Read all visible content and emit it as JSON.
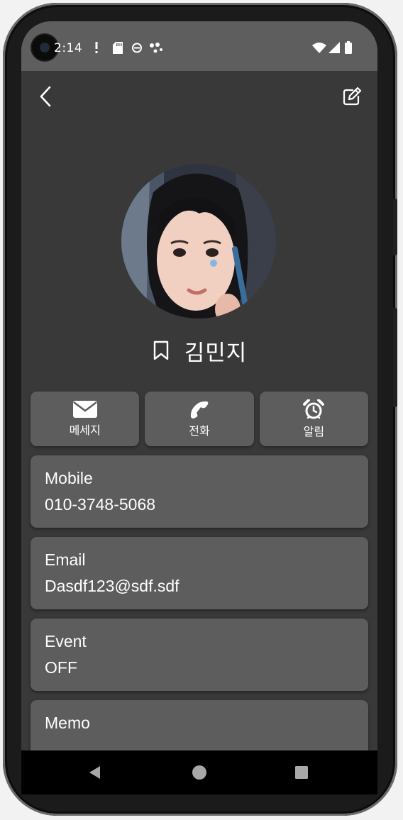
{
  "status": {
    "time": "2:14",
    "left_icons": [
      "alert-icon",
      "sd-card-icon",
      "sync-icon",
      "dots-icon"
    ],
    "right_icons": [
      "wifi-icon",
      "signal-icon",
      "battery-icon"
    ]
  },
  "toolbar": {
    "back_icon": "chevron-left-icon",
    "edit_icon": "edit-icon"
  },
  "contact": {
    "name": "김민지",
    "bookmark_icon": "bookmark-icon"
  },
  "actions": [
    {
      "label": "메세지",
      "icon": "envelope-icon"
    },
    {
      "label": "전화",
      "icon": "phone-icon"
    },
    {
      "label": "알림",
      "icon": "alarm-icon"
    }
  ],
  "fields": [
    {
      "label": "Mobile",
      "value": "010-3748-5068"
    },
    {
      "label": "Email",
      "value": "Dasdf123@sdf.sdf"
    },
    {
      "label": "Event",
      "value": "OFF"
    },
    {
      "label": "Memo",
      "value": ""
    }
  ],
  "navbar": {
    "icons": [
      "back-triangle-icon",
      "home-circle-icon",
      "recents-square-icon"
    ]
  },
  "colors": {
    "screen_bg": "#393939",
    "card_bg": "#5d5d5d",
    "status_bg": "#5e5e5e",
    "text": "#ffffff"
  }
}
